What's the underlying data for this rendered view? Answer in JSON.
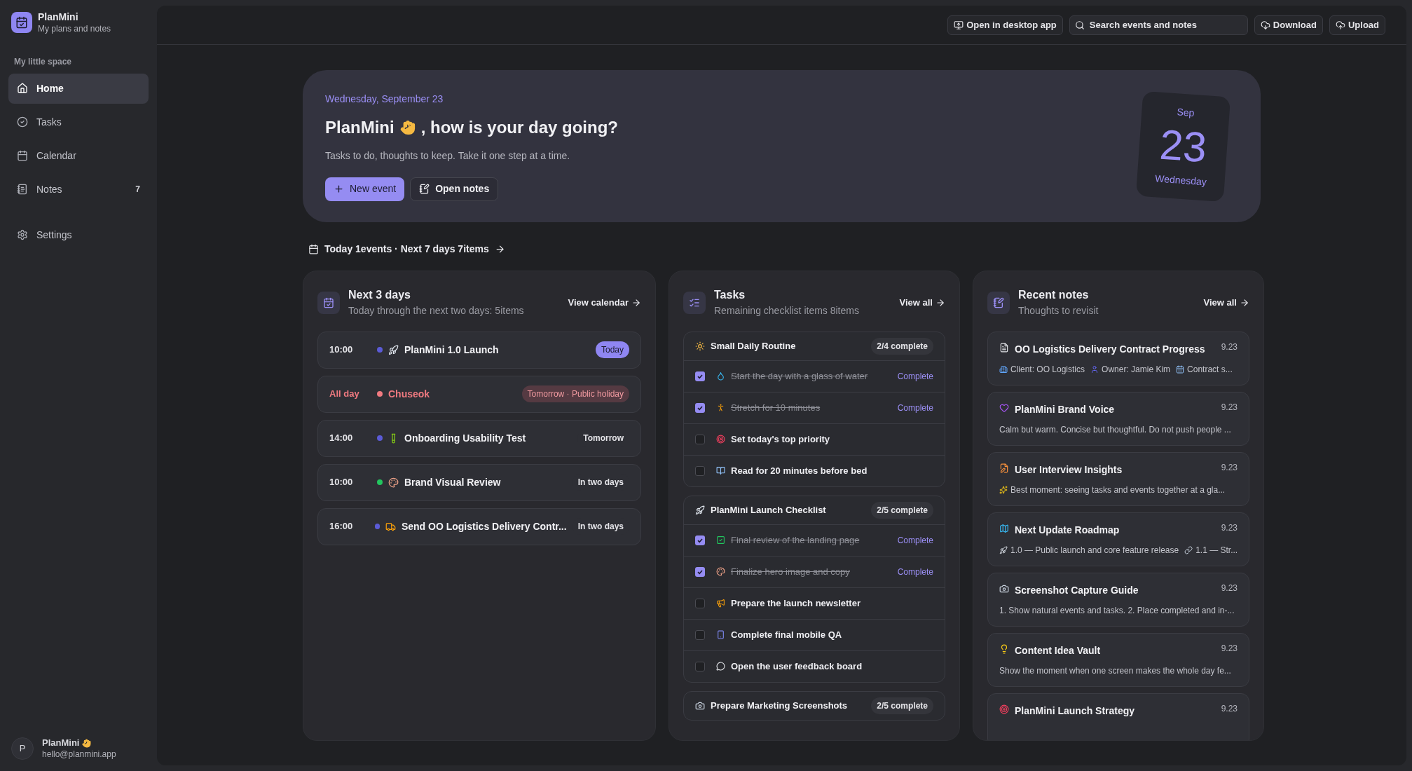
{
  "sidebar": {
    "app_name": "PlanMini",
    "app_subtitle": "My plans and notes",
    "section_label": "My little space",
    "items": [
      {
        "label": "Home",
        "selected": true
      },
      {
        "label": "Tasks",
        "selected": false
      },
      {
        "label": "Calendar",
        "selected": false
      },
      {
        "label": "Notes",
        "selected": false,
        "count": "7"
      },
      {
        "label": "Settings",
        "selected": false
      }
    ],
    "user": {
      "initial": "P",
      "name": "PlanMini",
      "email": "hello@planmini.app"
    }
  },
  "toolbar": {
    "open_desktop": "Open in desktop app",
    "search": {
      "placeholder": "Search events and notes"
    },
    "download": "Download",
    "upload": "Upload"
  },
  "hero": {
    "date": "Wednesday, September 23",
    "greeting_name": "PlanMini",
    "greeting_rest": ", how is your day going?",
    "subtitle": "Tasks to do, thoughts to keep. Take it one step at a time.",
    "primary_button": "New event",
    "secondary_button": "Open notes",
    "calendar_card": {
      "month": "Sep",
      "day": "23",
      "weekday": "Wednesday"
    }
  },
  "summary": "Today 1events · Next 7 days 7items",
  "events_panel": {
    "title": "Next 3 days",
    "subtitle": "Today through the next two days: 5items",
    "link": "View calendar",
    "events": [
      {
        "time": "10:00",
        "color": "#5b5bd6",
        "title": "PlanMini 1.0 Launch",
        "badge": "Today",
        "kind": "today"
      },
      {
        "time": "All day",
        "color": "#f07a80",
        "title": "Chuseok",
        "badge": "Tomorrow · Public holiday",
        "kind": "holiday"
      },
      {
        "time": "14:00",
        "color": "#5b5bd6",
        "title": "Onboarding Usability Test",
        "badge": "Tomorrow",
        "kind": "normal"
      },
      {
        "time": "10:00",
        "color": "#22c55e",
        "title": "Brand Visual Review",
        "badge": "In two days",
        "kind": "normal"
      },
      {
        "time": "16:00",
        "color": "#5b5bd6",
        "title": "Send OO Logistics Delivery Contr...",
        "badge": "In two days",
        "kind": "normal"
      }
    ]
  },
  "tasks_panel": {
    "title": "Tasks",
    "subtitle": "Remaining checklist items 8items",
    "link": "View all",
    "groups": [
      {
        "title": "Small Daily Routine",
        "progress": "2/4 complete",
        "items": [
          {
            "text": "Start the day with a glass of water",
            "checked": true,
            "status": "Complete"
          },
          {
            "text": "Stretch for 10 minutes",
            "checked": true,
            "status": "Complete"
          },
          {
            "text": "Set today's top priority",
            "checked": false
          },
          {
            "text": "Read for 20 minutes before bed",
            "checked": false
          }
        ]
      },
      {
        "title": "PlanMini Launch Checklist",
        "progress": "2/5 complete",
        "items": [
          {
            "text": "Final review of the landing page",
            "checked": true,
            "status": "Complete"
          },
          {
            "text": "Finalize hero image and copy",
            "checked": true,
            "status": "Complete"
          },
          {
            "text": "Prepare the launch newsletter",
            "checked": false
          },
          {
            "text": "Complete final mobile QA",
            "checked": false
          },
          {
            "text": "Open the user feedback board",
            "checked": false
          }
        ]
      },
      {
        "title": "Prepare Marketing Screenshots",
        "progress": "2/5 complete"
      }
    ]
  },
  "notes_panel": {
    "title": "Recent notes",
    "subtitle": "Thoughts to revisit",
    "link": "View all",
    "notes": [
      {
        "title": "OO Logistics Delivery Contract Progress",
        "date": "9.23",
        "preview": [
          "Client: OO Logistics",
          "Owner: Jamie Kim",
          "Contract s..."
        ]
      },
      {
        "title": "PlanMini Brand Voice",
        "date": "9.23",
        "preview": [
          "Calm but warm. Concise but thoughtful. Do not push people ..."
        ]
      },
      {
        "title": "User Interview Insights",
        "date": "9.23",
        "preview": [
          "Best moment: seeing tasks and events together at a gla..."
        ]
      },
      {
        "title": "Next Update Roadmap",
        "date": "9.23",
        "preview": [
          "1.0 — Public launch and core feature release",
          "1.1 — Str..."
        ]
      },
      {
        "title": "Screenshot Capture Guide",
        "date": "9.23",
        "preview": [
          "1. Show natural events and tasks. 2. Place completed and in-..."
        ]
      },
      {
        "title": "Content Idea Vault",
        "date": "9.23",
        "preview": [
          "Show the moment when one screen makes the whole day fe..."
        ]
      },
      {
        "title": "PlanMini Launch Strategy",
        "date": "9.23"
      }
    ]
  }
}
